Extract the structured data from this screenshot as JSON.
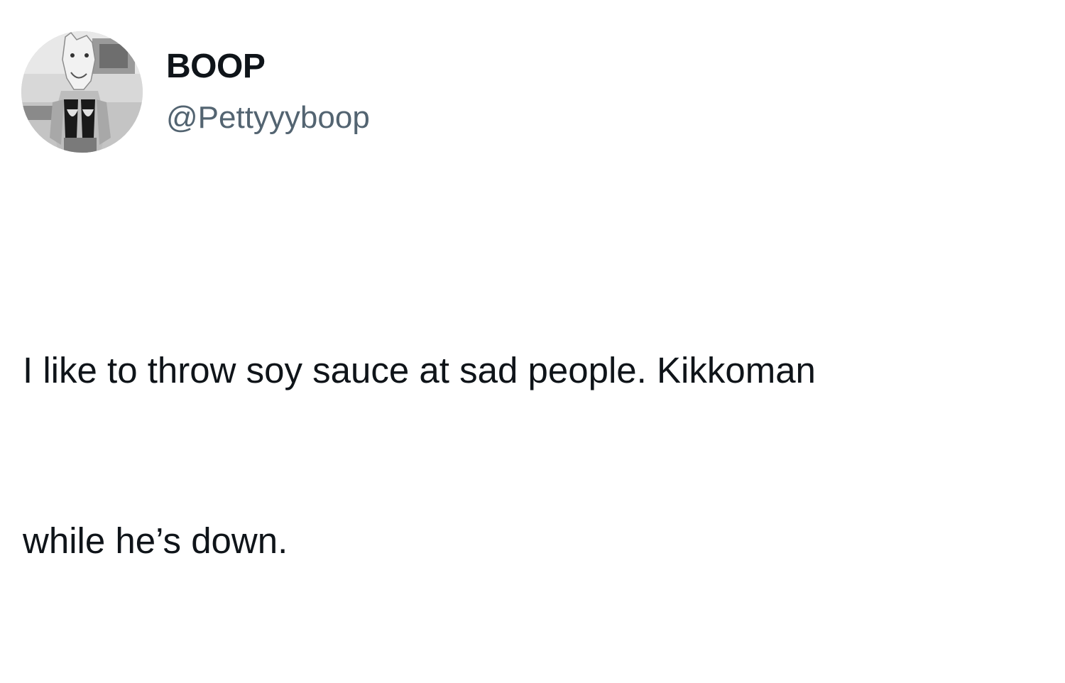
{
  "tweet": {
    "author": {
      "display_name": "BOOP",
      "handle": "@Pettyyyboop",
      "avatar_icon": "profile-photo-avatar"
    },
    "text_line1": "I like to throw soy sauce at sad people. Kikkoman",
    "text_line2": "while he’s down."
  },
  "colors": {
    "background": "#ffffff",
    "primary_text": "#0f1419",
    "secondary_text": "#536471"
  }
}
